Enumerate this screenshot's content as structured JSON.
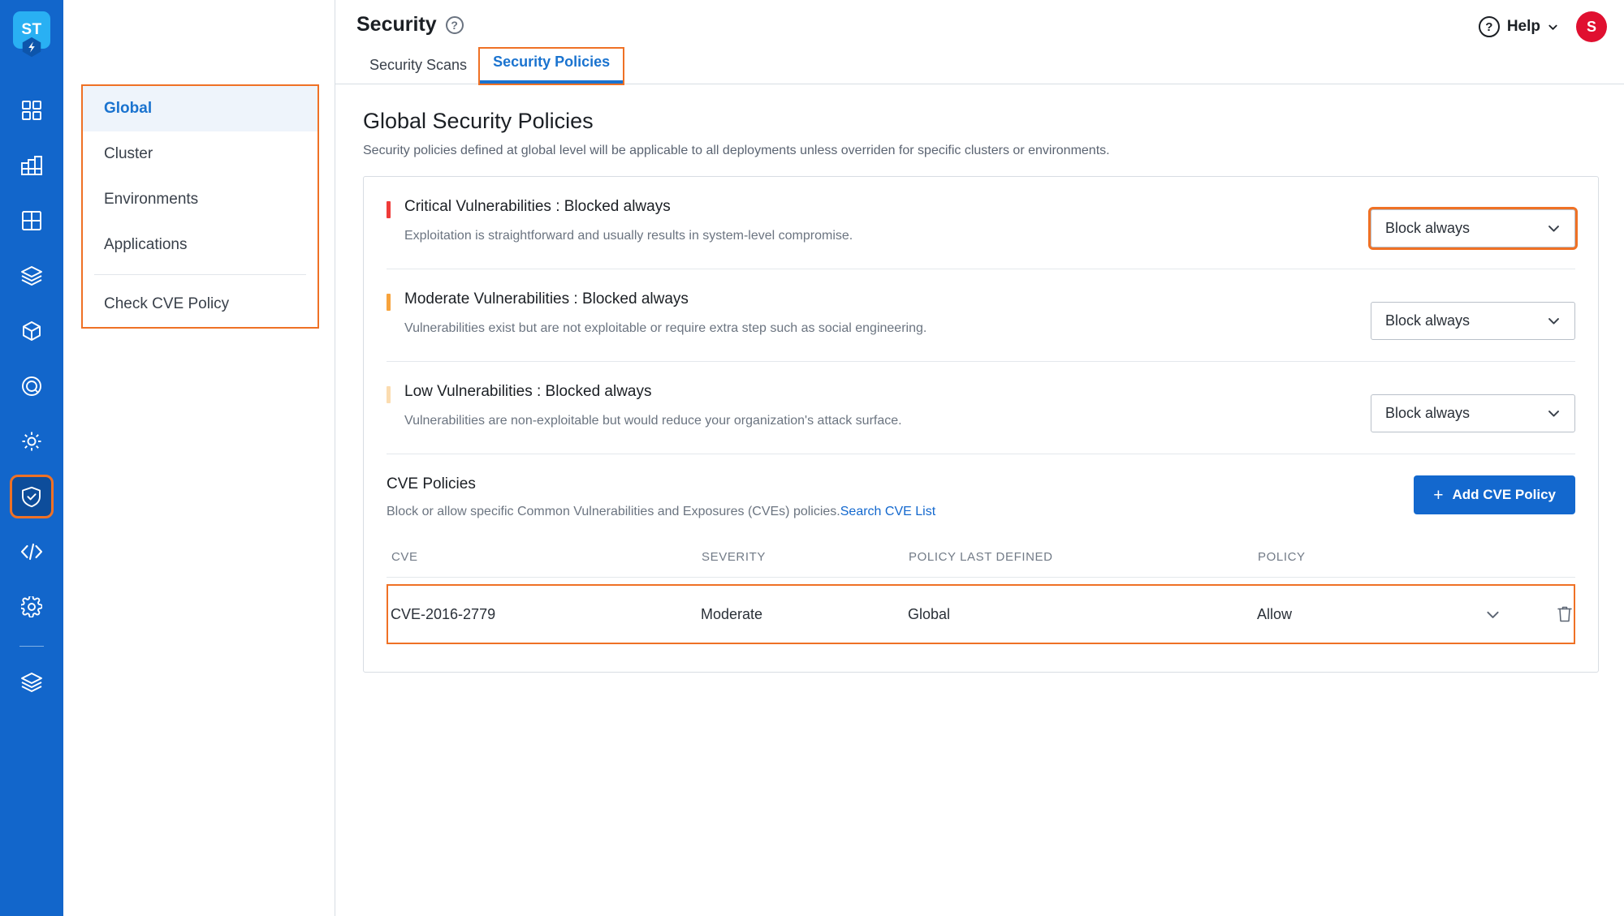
{
  "brand": {
    "logo_text": "ST",
    "accent_blue": "#1266cb",
    "highlight_orange": "#ef7125"
  },
  "rail": {
    "items": [
      {
        "name": "dashboard-icon",
        "label": "Dashboard"
      },
      {
        "name": "grid-chart-icon",
        "label": "Builds"
      },
      {
        "name": "table-icon",
        "label": "Deployments"
      },
      {
        "name": "open-box-icon",
        "label": "Artifacts"
      },
      {
        "name": "cube-icon",
        "label": "Environments"
      },
      {
        "name": "target-icon",
        "label": "Targets"
      },
      {
        "name": "gear-sun-icon",
        "label": "Chaos"
      },
      {
        "name": "shield-check-icon",
        "label": "Security"
      },
      {
        "name": "code-brackets-icon",
        "label": "Code"
      },
      {
        "name": "settings-gear-icon",
        "label": "Settings"
      },
      {
        "name": "layers-icon",
        "label": "Projects"
      }
    ],
    "active_index": 7
  },
  "header": {
    "title": "Security",
    "help_glyph": "?",
    "tabs": [
      {
        "label": "Security Scans",
        "active": false
      },
      {
        "label": "Security Policies",
        "active": true
      }
    ],
    "help_label": "Help",
    "avatar_initial": "S"
  },
  "subnav": {
    "items": [
      {
        "label": "Global",
        "selected": true
      },
      {
        "label": "Cluster",
        "selected": false
      },
      {
        "label": "Environments",
        "selected": false
      },
      {
        "label": "Applications",
        "selected": false
      }
    ],
    "footer_item": {
      "label": "Check CVE Policy"
    }
  },
  "main": {
    "title": "Global Security Policies",
    "subtitle": "Security policies defined at global level will be applicable to all deployments unless overriden for specific clusters or environments.",
    "policies": [
      {
        "name": "Critical Vulnerabilities : Blocked always",
        "description": "Exploitation is straightforward and usually results in system-level compromise.",
        "severity_color": "#ef3b39",
        "select_value": "Block always",
        "highlighted": true
      },
      {
        "name": "Moderate Vulnerabilities : Blocked always",
        "description": "Vulnerabilities exist but are not exploitable or require extra step such as social engineering.",
        "severity_color": "#f7a33c",
        "select_value": "Block always",
        "highlighted": false
      },
      {
        "name": "Low Vulnerabilities : Blocked always",
        "description": "Vulnerabilities are non-exploitable but would reduce your organization's attack surface.",
        "severity_color": "#fbdcb0",
        "select_value": "Block always",
        "highlighted": false
      }
    ],
    "cve_section": {
      "title": "CVE Policies",
      "description": "Block or allow specific Common Vulnerabilities and Exposures (CVEs) policies.",
      "link_text": "Search CVE List",
      "add_button": "Add CVE Policy",
      "add_button_plus": "+",
      "table": {
        "columns": [
          "CVE",
          "SEVERITY",
          "POLICY LAST DEFINED",
          "POLICY"
        ],
        "rows": [
          {
            "cve": "CVE-2016-2779",
            "severity": "Moderate",
            "policy_last_defined": "Global",
            "policy": "Allow"
          }
        ]
      }
    }
  }
}
